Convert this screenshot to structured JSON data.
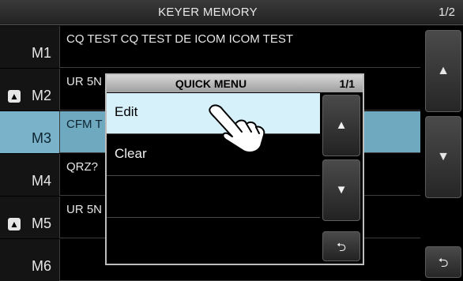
{
  "titlebar": {
    "title": "KEYER MEMORY",
    "page": "1/2"
  },
  "rows": [
    {
      "name": "M1",
      "content": "CQ TEST CQ TEST DE ICOM ICOM TEST",
      "locked": false
    },
    {
      "name": "M2",
      "content": "UR 5N",
      "locked": true
    },
    {
      "name": "M3",
      "content": "CFM T",
      "locked": false,
      "selected": true
    },
    {
      "name": "M4",
      "content": "QRZ?",
      "locked": false
    },
    {
      "name": "M5",
      "content": "UR 5N",
      "locked": true
    },
    {
      "name": "M6",
      "content": "",
      "locked": false
    }
  ],
  "sidebar": {
    "up_icon": "up-arrow",
    "down_icon": "down-arrow",
    "back_icon": "return-arrow"
  },
  "quick_menu": {
    "title": "QUICK MENU",
    "page": "1/1",
    "items": [
      "Edit",
      "Clear",
      "",
      ""
    ],
    "selected_index": 0
  },
  "icons": {
    "lock": "lock-icon",
    "cursor": "touch-hand-icon"
  },
  "colors": {
    "selected_row": "#6fa9c0",
    "selected_menu_item": "#d7f1fb"
  }
}
